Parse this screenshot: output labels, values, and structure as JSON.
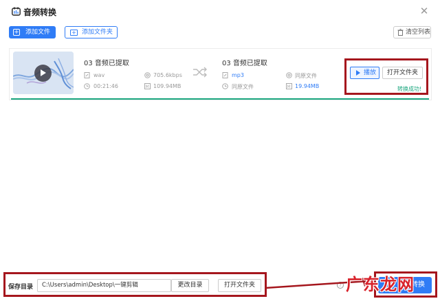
{
  "window": {
    "title": "音频转换",
    "close_icon": "close-icon"
  },
  "toolbar": {
    "add_file_label": "添加文件",
    "add_folder_label": "添加文件夹",
    "clear_list_label": "清空列表"
  },
  "file_item": {
    "source": {
      "name": "03 音频已提取",
      "format": "wav",
      "bitrate": "705.6kbps",
      "duration": "00:21:46",
      "size": "109.94MB"
    },
    "target": {
      "name": "03 音频已提取",
      "format": "mp3",
      "bitrate": "同原文件",
      "duration": "同原文件",
      "size": "19.94MB"
    },
    "play_label": "播放",
    "open_folder_label": "打开文件夹",
    "status": "转换成功!"
  },
  "bottom": {
    "save_dir_label": "保存目录",
    "save_path": "C:\\Users\\admin\\Desktop\\一键剪辑",
    "change_dir_label": "更改目录",
    "open_folder_label": "打开文件夹",
    "convert_label": "一键转换"
  },
  "watermark": "广东龙网",
  "colors": {
    "accent": "#2f7cf6",
    "success": "#1aa67e",
    "highlight_box": "#a5161d"
  }
}
